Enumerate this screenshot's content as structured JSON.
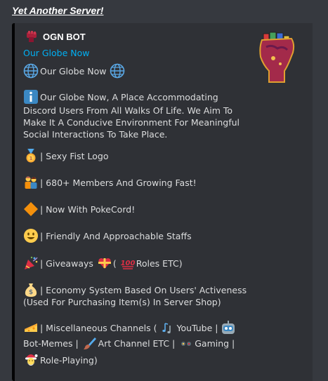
{
  "server_heading": "Yet Another Server!",
  "embed": {
    "author": "OGN BOT",
    "title_link": "Our Globe Now",
    "globe_line": "Our Globe Now",
    "description": "Our Globe Now, A Place Accommodating Discord Users From All Walks Of Life. We Aim To Make It A Conducive Environment For Meaningful Social Interactions To Take Place.",
    "features": {
      "logo": "| Sexy Fist Logo",
      "members": "| 680+ Members And Growing Fast!",
      "pokecord": "| Now With PokeCord!",
      "staff": "| Friendly And Approachable Staffs",
      "giveaways_a": "| Giveaways",
      "giveaways_b": "(",
      "giveaways_c": "Roles ETC)",
      "economy_1": "| Economy System Based On Users' Activeness",
      "economy_2": "(Used For Purchasing Item(s) In Server Shop)",
      "misc_a": "| Miscellaneous Channels (",
      "misc_b": "YouTube |",
      "misc_c": "Bot-Memes |",
      "misc_d": "Art Channel ETC |",
      "misc_e": "Gaming |",
      "misc_f": "Role-Playing)"
    }
  },
  "icons": [
    "fist-icon",
    "globe-icon",
    "info-icon",
    "medal-icon",
    "family-icon",
    "orange-diamond-icon",
    "smiley-icon",
    "party-popper-icon",
    "gift-heart-icon",
    "hundred-icon",
    "money-bag-icon",
    "cheese-icon",
    "notes-icon",
    "robot-icon",
    "paintbrush-icon",
    "gamepad-icon",
    "santa-icon"
  ],
  "colors": {
    "background": "#36393f",
    "embed": "#2f3136",
    "link": "#00b0f4",
    "text": "#dcddde"
  }
}
